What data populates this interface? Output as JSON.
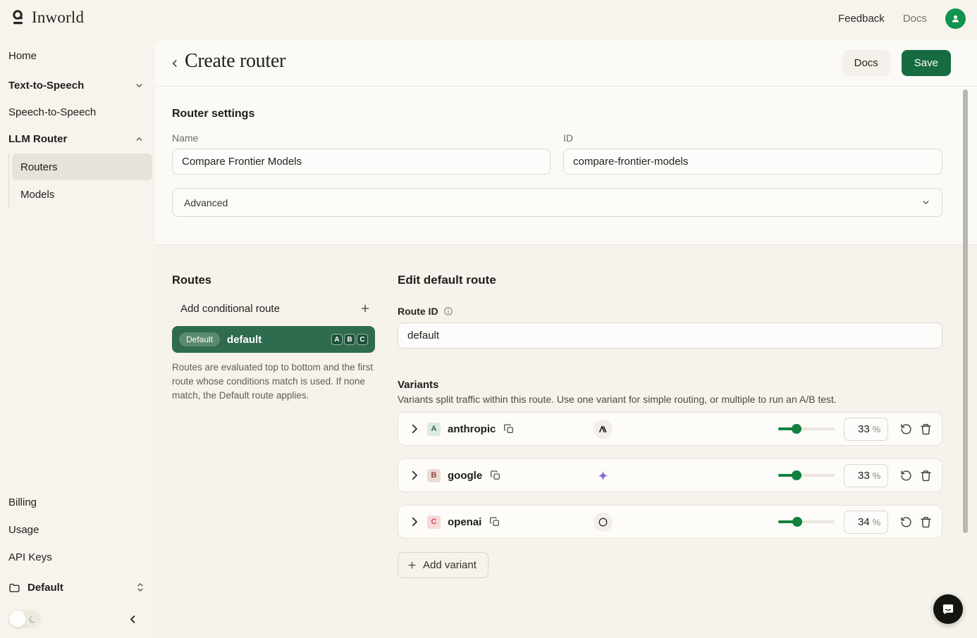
{
  "topbar": {
    "brand": "Inworld",
    "feedback_link": "Feedback",
    "docs_link": "Docs"
  },
  "sidebar": {
    "items": [
      {
        "label": "Home"
      },
      {
        "label": "Text-to-Speech"
      },
      {
        "label": "Speech-to-Speech"
      },
      {
        "label": "LLM Router"
      }
    ],
    "sub_items": [
      {
        "label": "Routers"
      },
      {
        "label": "Models"
      }
    ],
    "footer_items": [
      {
        "label": "Billing"
      },
      {
        "label": "Usage"
      },
      {
        "label": "API Keys"
      }
    ],
    "workspace": "Default"
  },
  "header": {
    "title": "Create router",
    "docs_button": "Docs",
    "save_button": "Save"
  },
  "router_settings": {
    "heading": "Router settings",
    "name_label": "Name",
    "name_value": "Compare Frontier Models",
    "id_label": "ID",
    "id_value": "compare-frontier-models",
    "advanced_label": "Advanced"
  },
  "routes": {
    "heading": "Routes",
    "add_conditional_label": "Add conditional route",
    "route": {
      "default_badge": "Default",
      "name": "default",
      "variant_badges": {
        "0": "A",
        "1": "B",
        "2": "C"
      }
    },
    "description": "Routes are evaluated top to bottom and the first route whose conditions match is used. If none match, the Default route applies."
  },
  "edit_route": {
    "heading": "Edit default route",
    "route_id_label": "Route ID",
    "route_id_value": "default",
    "variants_heading": "Variants",
    "variants_description": "Variants split traffic within this route. Use one variant for simple routing, or multiple to run an A/B test.",
    "percent_symbol": "%",
    "variants": [
      {
        "letter": "A",
        "name": "anthropic",
        "provider": "anthropic",
        "percent": "33"
      },
      {
        "letter": "B",
        "name": "google",
        "provider": "google",
        "percent": "33"
      },
      {
        "letter": "C",
        "name": "openai",
        "provider": "openai",
        "percent": "34"
      }
    ],
    "add_variant_label": "Add variant"
  },
  "colors": {
    "accent_green": "#166b41",
    "route_green": "#2f6c4f",
    "slider_green": "#12813e",
    "avatar_green": "#13934d",
    "page_cream": "#f7f4ed"
  }
}
